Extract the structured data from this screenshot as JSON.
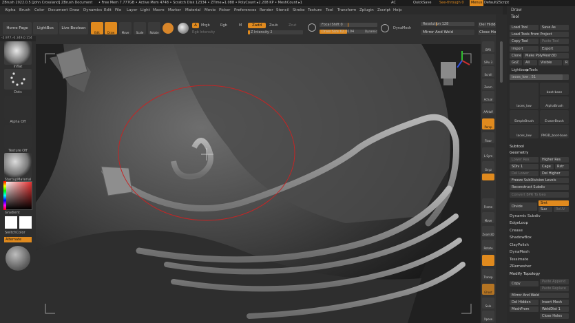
{
  "titlebar": {
    "app": "ZBrush 2022.0.5 [John Crossland]",
    "doc": "ZBrush Document",
    "mem": "• Free Mem 7.777GB • Active Mem 4748 • Scratch Disk 12334 • ZTime ▸1.088 • PolyCount ▸2.208 KP • MeshCount ▸1",
    "ac": "AC",
    "quicksave": "QuickSave",
    "seethrough": "See-through 0",
    "menus": "Menus",
    "defaultzscript": "DefaultZScript"
  },
  "menubar": [
    "Alpha",
    "Brush",
    "Color",
    "Document",
    "Draw",
    "Dynamics",
    "Edit",
    "File",
    "Layer",
    "Light",
    "Macro",
    "Marker",
    "Material",
    "Movie",
    "Picker",
    "Preferences",
    "Render",
    "Stencil",
    "Stroke",
    "Texture",
    "Tool",
    "Transform",
    "Zplugin",
    "Zscript",
    "Help"
  ],
  "toolbar": {
    "home_page": "Home Page",
    "lightbox": "LightBox",
    "live_boolean": "Live Boolean",
    "edit": "Edit",
    "draw": "Draw",
    "move": "Move",
    "scale": "Scale",
    "rotate": "Rotate",
    "a": "A",
    "mrgb": "Mrgb",
    "rgb": "Rgb",
    "m": "M",
    "zadd": "Zadd",
    "zsub": "Zsub",
    "zcut": "Zcut",
    "rgb_intensity": "Rgb Intensity",
    "z_intensity": "Z Intensity 2",
    "focal_shift": "Focal Shift 0",
    "draw_size": "Draw Size 62.0104",
    "dynamic": "Dynamic",
    "dynamesh": "DynaMesh",
    "resolution": "Resolution 128",
    "mirror_weld": "Mirror And Weld",
    "del_hidden": "Del Hidde",
    "close_holes": "Close Hol"
  },
  "coords": "-2.977,-0.349,0.154",
  "leftpanel": {
    "inflat": "Inflat",
    "dots": "Dots",
    "alpha_off": "Alpha Off",
    "texture_off": "Texture Off",
    "startup_material": "StartupMaterial",
    "gradient": "Gradient",
    "switchcolor": "SwitchColor",
    "alternate": "Alternate"
  },
  "iconstrip": [
    "BPR",
    "SPix 3",
    "Scroll",
    "Zoom",
    "Actual",
    "AAHalf",
    "Persp",
    "Floor",
    "L.Sym",
    "Gxyz",
    "Frame",
    "Move",
    "Zoom3D",
    "Rotate",
    "Transp",
    "Ghost",
    "Solo",
    "Xpose"
  ],
  "toolpanel": {
    "draw_tab": "Draw",
    "tool_title": "Tool",
    "load_tool": "Load Tool",
    "save_as": "Save As",
    "load_from_project": "Load Tools From Project",
    "copy_tool": "Copy Tool",
    "paste_tool": "Paste Tool",
    "import": "Import",
    "export": "Export",
    "clone": "Clone",
    "make_polymesh": "Make PolyMesh3D",
    "goz": "GoZ",
    "all": "All",
    "visible": "Visible",
    "r": "R",
    "lightbox_tools": "Lightbox▶Tools",
    "laces_low": "laces_low . 51",
    "brushes": [
      {
        "name": "laces_low"
      },
      {
        "name": "boot-base"
      },
      {
        "name": "AlphaBrush"
      },
      {
        "name": "SimpleBrush"
      },
      {
        "name": "EraserBrush"
      },
      {
        "name": "laces_low"
      },
      {
        "name": "PM3D_boot-base"
      }
    ],
    "subtool": "Subtool",
    "geometry": "Geometry",
    "lower_res": "Lower Res",
    "higher_res": "Higher Res",
    "sdiv": "SDiv 1",
    "cage": "Cage",
    "rstr": "Rstr",
    "del_lower": "Del Lower",
    "del_higher": "Del Higher",
    "freeze_subdiv": "Freeze SubDivision Levels",
    "reconstruct_subdiv": "Reconstruct Subdiv",
    "convert_bpr": "Convert BPR To Geo",
    "divide": "Divide",
    "smt": "Smt",
    "suv": "Suv",
    "reuv": "ReUV",
    "dynamic_subdiv": "Dynamic Subdiv",
    "edgeloop": "EdgeLoop",
    "crease": "Crease",
    "shadowbox": "ShadowBox",
    "claypolish": "ClayPolish",
    "dynamesh": "DynaMesh",
    "tessimate": "Tessimate",
    "zremesher": "ZRemesher",
    "modify_topology": "Modify Topology",
    "copy": "Copy",
    "paste_append": "Paste Append",
    "paste_replace": "Paste Replace",
    "mirror_and_weld": "Mirror And Weld",
    "del_hidden": "Del Hidden",
    "insert_mesh": "Insert Mesh",
    "meshfrom": "MeshFrom",
    "weld_dist": "WeldDist 1",
    "close_holes": "Close Holes"
  },
  "accent": "#e08a1e"
}
